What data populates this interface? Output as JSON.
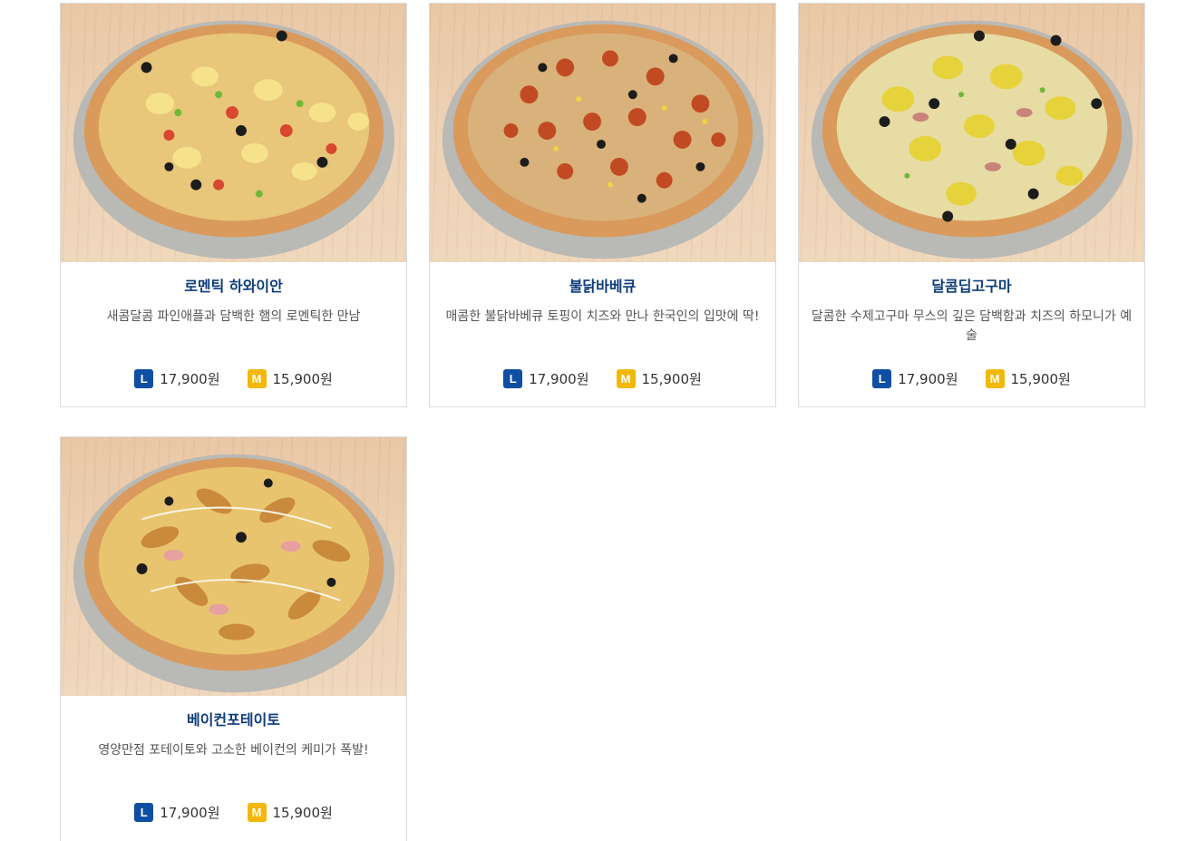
{
  "colors": {
    "name_text": "#0d3c7a",
    "large_badge": "#0f4fa3",
    "medium_badge": "#f2b707",
    "card_border": "#dcdcdc"
  },
  "products": [
    {
      "name": "로멘틱 하와이안",
      "description": "새콤달콤 파인애플과 담백한 햄의 로멘틱한 만남",
      "large": {
        "badge": "L",
        "price": "17,900원"
      },
      "medium": {
        "badge": "M",
        "price": "15,900원"
      }
    },
    {
      "name": "불닭바베큐",
      "description": "매콤한 불닭바베큐 토핑이 치즈와 만나 한국인의 입맛에 딱!",
      "large": {
        "badge": "L",
        "price": "17,900원"
      },
      "medium": {
        "badge": "M",
        "price": "15,900원"
      }
    },
    {
      "name": "달콤딥고구마",
      "description": "달콤한 수제고구마 무스의 깊은 담백함과 치즈의 하모니가 예술",
      "large": {
        "badge": "L",
        "price": "17,900원"
      },
      "medium": {
        "badge": "M",
        "price": "15,900원"
      }
    },
    {
      "name": "베이컨포테이토",
      "description": "영양만점 포테이토와 고소한 베이컨의 케미가 폭발!",
      "large": {
        "badge": "L",
        "price": "17,900원"
      },
      "medium": {
        "badge": "M",
        "price": "15,900원"
      }
    }
  ]
}
